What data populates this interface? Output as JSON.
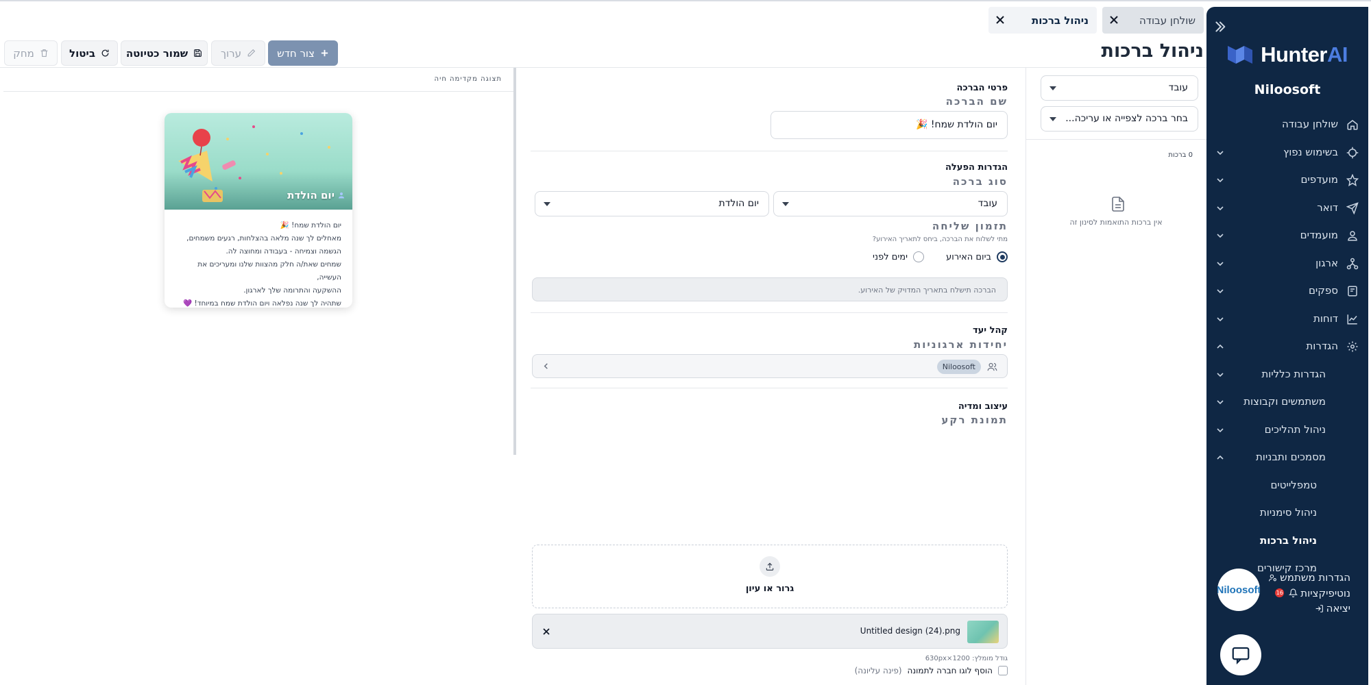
{
  "sidebar": {
    "logo_text": "Hunter",
    "logo_ai": "AI",
    "org_name": "Niloosoft",
    "items": [
      {
        "label": "שולחן עבודה",
        "icon": "home-icon"
      },
      {
        "label": "בשימוש נפוץ",
        "icon": "target-icon"
      },
      {
        "label": "מועדפים",
        "icon": "star-icon"
      },
      {
        "label": "דואר",
        "icon": "send-icon"
      },
      {
        "label": "מועמדים",
        "icon": "user-icon"
      },
      {
        "label": "ארגון",
        "icon": "org-icon"
      },
      {
        "label": "ספקים",
        "icon": "supplier-icon"
      },
      {
        "label": "דוחות",
        "icon": "chart-icon"
      },
      {
        "label": "הגדרות",
        "icon": "gear-icon"
      },
      {
        "label": "הגדרות כלליות"
      },
      {
        "label": "משתמשים וקבוצות"
      },
      {
        "label": "ניהול תהליכים"
      },
      {
        "label": "מסמכים ותבניות"
      },
      {
        "label": "טמפלייטים"
      },
      {
        "label": "ניהול סימניות"
      },
      {
        "label": "ניהול ברכות"
      },
      {
        "label": "מרכז קישורים"
      }
    ],
    "user": {
      "avatar_text": "Niloosoft",
      "settings_label": "הגדרות משתמש",
      "notifications_label": "נוטיפיקציות",
      "notifications_count": "16",
      "logout_label": "יציאה"
    }
  },
  "tabs": [
    {
      "label": "שולחן עבודה"
    },
    {
      "label": "ניהול ברכות"
    }
  ],
  "page_title": "ניהול ברכות",
  "toolbar": {
    "new_label": "צור חדש",
    "edit_label": "ערוך",
    "save_draft_label": "שמור כטיוטה",
    "cancel_label": "ביטול",
    "delete_label": "מחק"
  },
  "filter_panel": {
    "type_value": "עובד",
    "greeting_select_placeholder": "בחר ברכה לצפייה או עריכה...",
    "count_label": "0 ברכות",
    "empty_text": "אין ברכות התואמות לסינון זה"
  },
  "form": {
    "details_title": "פרטי הברכה",
    "name_label": "שם הברכה",
    "name_value": "יום הולדת שמח! 🎉",
    "activation_title": "הגדרות הפעלה",
    "type_label": "סוג ברכה",
    "type_value_1": "עובד",
    "type_value_2": "יום הולדת",
    "timing_label": "תזמון שליחה",
    "timing_hint": "מתי לשלוח את הברכה, ביחס לתאריך האירוע?",
    "radio_on_day": "ביום האירוע",
    "radio_days_before": "ימים לפני",
    "timing_info": "הברכה תישלח בתאריך המדויק של האירוע.",
    "audience_title": "קהל יעד",
    "units_label": "יחידות ארגוניות",
    "unit_chip": "Niloosoft",
    "design_title": "עיצוב ומדיה",
    "bg_label": "תמונת רקע",
    "drop_text": "גרור או עיון",
    "file_name": "Untitled design (24).png",
    "size_hint": "גודל מומלץ: 1200×630px",
    "logo_checkbox_label": "הוסף לוגו חברה לתמונה",
    "logo_checkbox_note": "(פינה עליונה)"
  },
  "preview": {
    "title": "תצוגה מקדימה חיה",
    "card_title": "יום הולדת",
    "card_lines": [
      "יום הולדת שמח! 🎉",
      "מאחלים לך שנה מלאה בהצלחות, רגעים משמחים,",
      "הגשמה וצמיחה - בעבודה ומחוצה לה.",
      "שמחים שאת/ה חלק מהצוות שלנו ומעריכים את העשייה,",
      "ההשקעה והתרומה שלך לארגון.",
      "שתהיה לך שנה נפלאה ויום הולדת שמח במיוחד! 💜"
    ]
  },
  "colors": {
    "sidebar_bg": "#0f2744",
    "primary_button": "#7c92b0",
    "accent_blue": "#4c7de0",
    "notification_badge": "#e53935"
  }
}
